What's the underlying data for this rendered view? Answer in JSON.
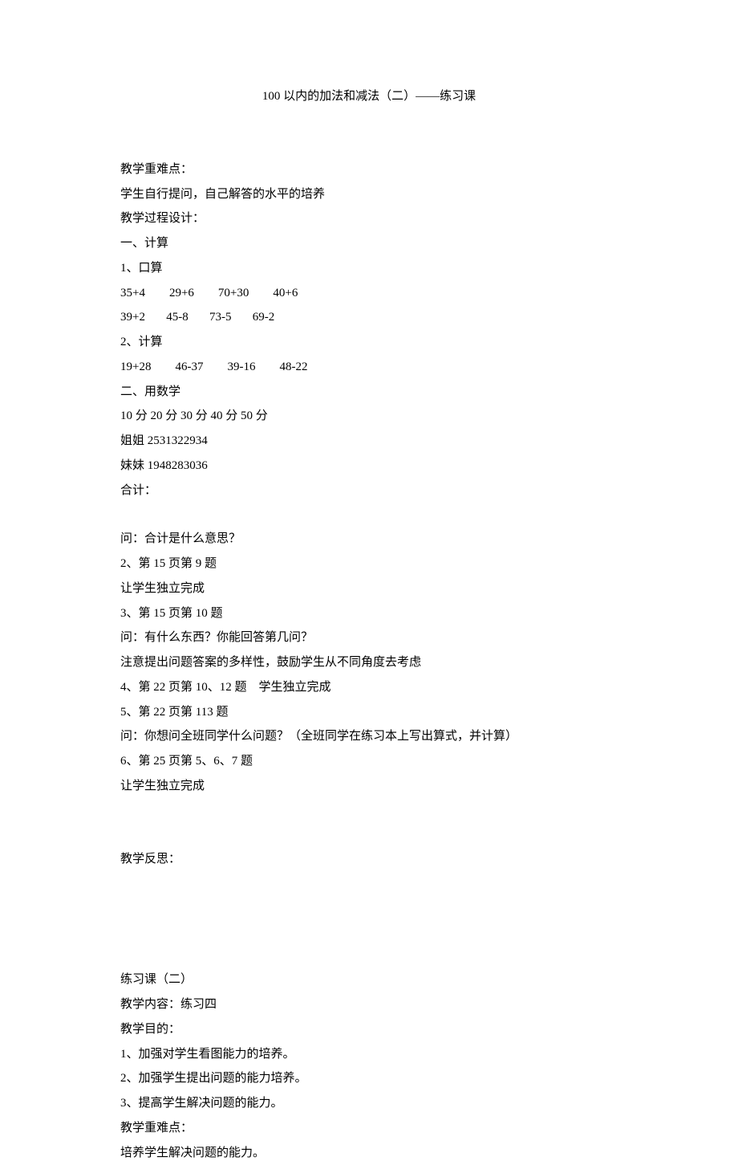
{
  "title": "100 以内的加法和减法（二）——练习课",
  "lines": [
    "教学重难点：",
    "学生自行提问，自己解答的水平的培养",
    "教学过程设计：",
    "一、计算",
    "1、口算",
    "35+4        29+6        70+30        40+6",
    "39+2       45-8       73-5       69-2",
    "2、计算",
    "19+28        46-37        39-16        48-22",
    "二、用数学",
    "10 分 20 分 30 分 40 分 50 分",
    "姐姐 2531322934",
    "妹妹 1948283036",
    "合计：",
    "",
    "问：合计是什么意思？",
    "2、第 15 页第 9 题",
    "让学生独立完成",
    "3、第 15 页第 10 题",
    "问：有什么东西？你能回答第几问？",
    "注意提出问题答案的多样性，鼓励学生从不同角度去考虑",
    "4、第 22 页第 10、12 题    学生独立完成",
    "5、第 22 页第 113 题",
    "问：你想问全班同学什么问题？（全班同学在练习本上写出算式，并计算）",
    "6、第 25 页第 5、6、7 题",
    "让学生独立完成",
    "",
    "",
    "教学反思：",
    "",
    "",
    "",
    "",
    "练习课（二）",
    "教学内容：练习四",
    "教学目的：",
    "1、加强对学生看图能力的培养。",
    "2、加强学生提出问题的能力培养。",
    "3、提高学生解决问题的能力。",
    "教学重难点：",
    "培养学生解决问题的能力。"
  ]
}
